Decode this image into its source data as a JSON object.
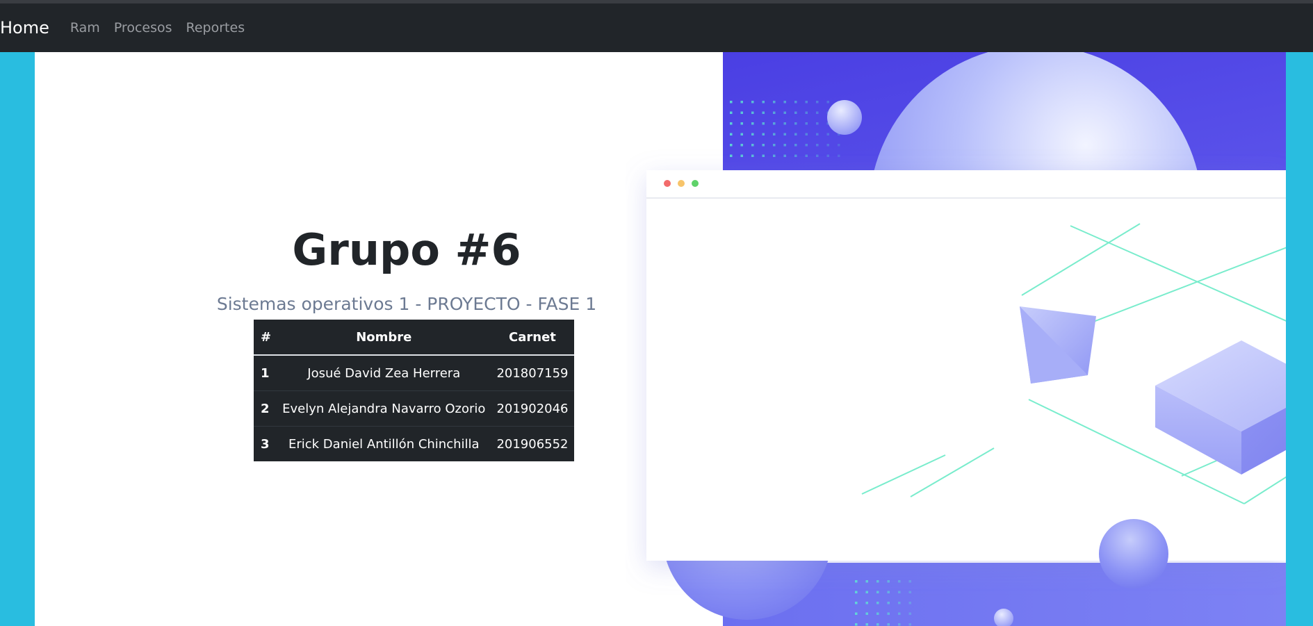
{
  "navbar": {
    "brand": "Home",
    "links": [
      "Ram",
      "Procesos",
      "Reportes"
    ]
  },
  "main": {
    "title": "Grupo #6",
    "subtitle": "Sistemas operativos 1 - PROYECTO - FASE 1",
    "table": {
      "headers": [
        "#",
        "Nombre",
        "Carnet"
      ],
      "rows": [
        {
          "num": "1",
          "nombre": "Josué David Zea Herrera",
          "carnet": "201807159"
        },
        {
          "num": "2",
          "nombre": "Evelyn Alejandra Navarro Ozorio",
          "carnet": "201902046"
        },
        {
          "num": "3",
          "nombre": "Erick Daniel Antillón Chinchilla",
          "carnet": "201906552"
        }
      ]
    }
  },
  "colors": {
    "page_bg": "#29bde0",
    "navbar_bg": "#212529",
    "table_bg": "#212529",
    "illustration_accent": "#5046e5",
    "illustration_line": "#58e8c0"
  },
  "icons": [
    "window-close-dot",
    "window-minimize-dot",
    "window-maximize-dot"
  ]
}
